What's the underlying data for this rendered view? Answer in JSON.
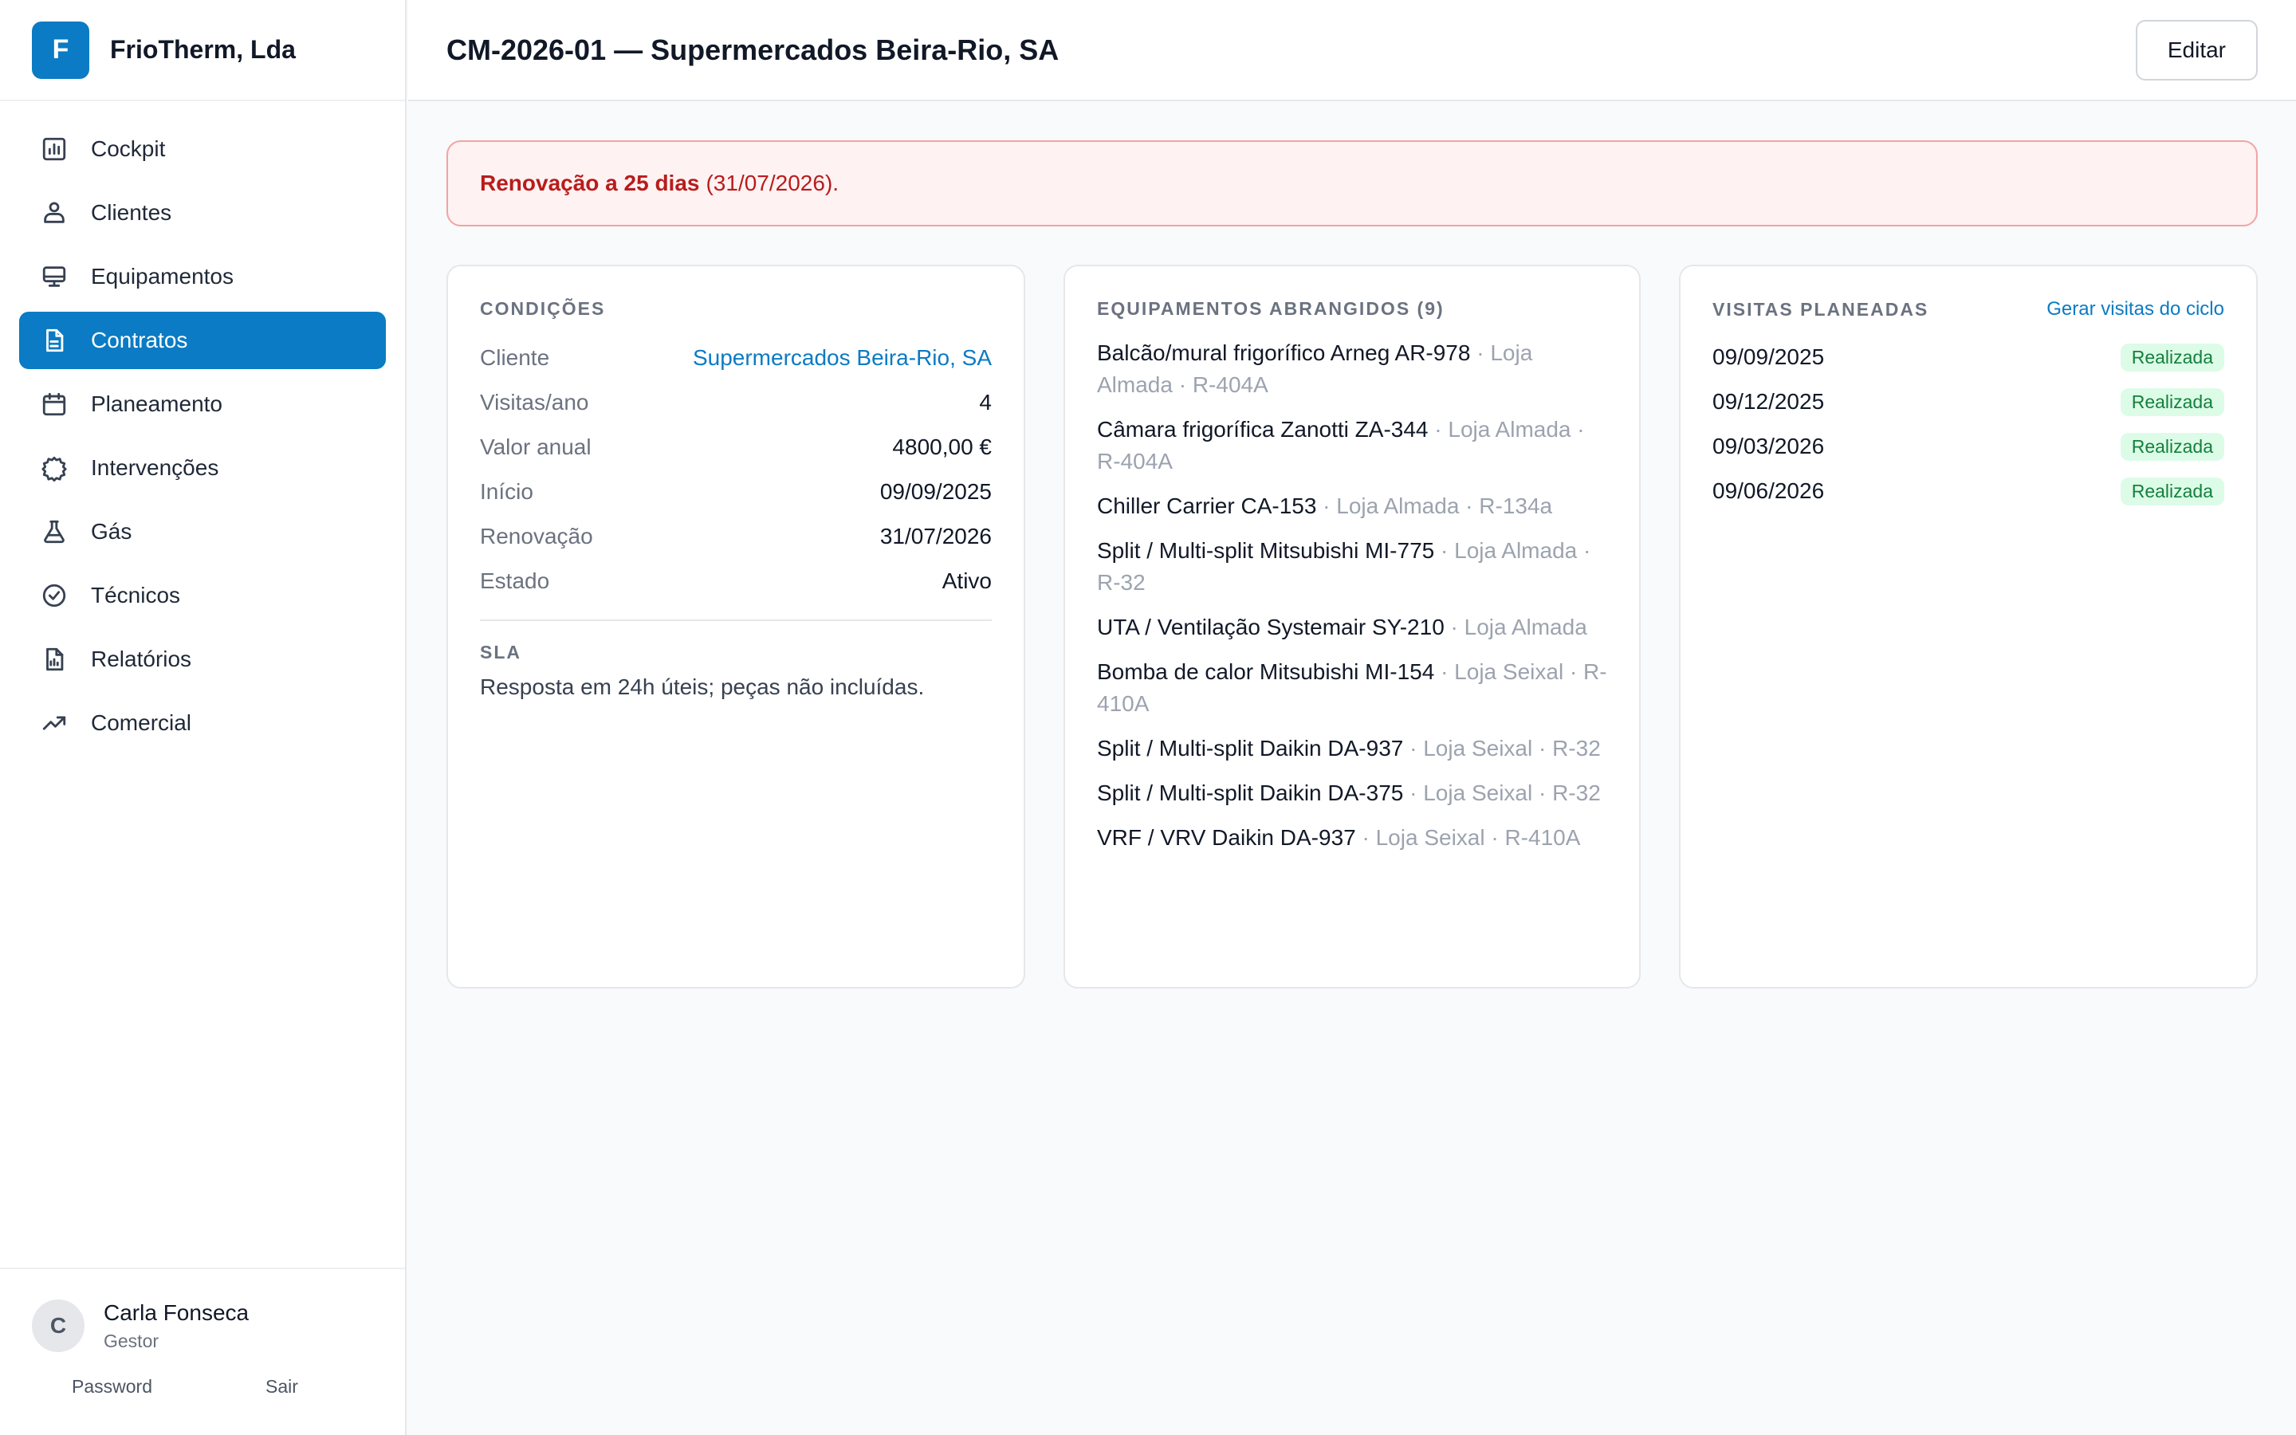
{
  "brand": {
    "initial": "F",
    "name": "FrioTherm, Lda"
  },
  "nav": [
    {
      "label": "Cockpit",
      "icon": "dashboard-icon",
      "active": false
    },
    {
      "label": "Clientes",
      "icon": "users-icon",
      "active": false
    },
    {
      "label": "Equipamentos",
      "icon": "monitor-icon",
      "active": false
    },
    {
      "label": "Contratos",
      "icon": "document-icon",
      "active": true
    },
    {
      "label": "Planeamento",
      "icon": "calendar-icon",
      "active": false
    },
    {
      "label": "Intervenções",
      "icon": "cog-icon",
      "active": false
    },
    {
      "label": "Gás",
      "icon": "flask-icon",
      "active": false
    },
    {
      "label": "Técnicos",
      "icon": "check-circle-icon",
      "active": false
    },
    {
      "label": "Relatórios",
      "icon": "report-icon",
      "active": false
    },
    {
      "label": "Comercial",
      "icon": "trending-up-icon",
      "active": false
    }
  ],
  "user": {
    "initial": "C",
    "name": "Carla Fonseca",
    "role": "Gestor",
    "password_label": "Password",
    "logout_label": "Sair"
  },
  "header": {
    "title": "CM-2026-01 — Supermercados Beira-Rio, SA",
    "edit_label": "Editar"
  },
  "alert": {
    "strong": "Renovação a 25 dias",
    "rest": "(31/07/2026)."
  },
  "conditions": {
    "title": "CONDIÇÕES",
    "rows": [
      {
        "k": "Cliente",
        "v": "Supermercados Beira-Rio, SA"
      },
      {
        "k": "Visitas/ano",
        "v": "4"
      },
      {
        "k": "Valor anual",
        "v": "4800,00 €"
      },
      {
        "k": "Início",
        "v": "09/09/2025"
      },
      {
        "k": "Renovação",
        "v": "31/07/2026"
      },
      {
        "k": "Estado",
        "v": "Ativo"
      }
    ],
    "sla_title": "SLA",
    "sla_text": "Resposta em 24h úteis; peças não incluídas."
  },
  "equipment": {
    "title": "EQUIPAMENTOS ABRANGIDOS (9)",
    "items": [
      {
        "name": "Balcão/mural frigorífico Arneg AR-978",
        "meta": " · Loja Almada · R-404A"
      },
      {
        "name": "Câmara frigorífica Zanotti ZA-344",
        "meta": " · Loja Almada · R-404A"
      },
      {
        "name": "Chiller Carrier CA-153",
        "meta": " · Loja Almada · R-134a"
      },
      {
        "name": "Split / Multi-split Mitsubishi MI-775",
        "meta": " · Loja Almada · R-32"
      },
      {
        "name": "UTA / Ventilação Systemair SY-210",
        "meta": " · Loja Almada"
      },
      {
        "name": "Bomba de calor Mitsubishi MI-154",
        "meta": " · Loja Seixal · R-410A"
      },
      {
        "name": "Split / Multi-split Daikin DA-937",
        "meta": " · Loja Seixal · R-32"
      },
      {
        "name": "Split / Multi-split Daikin DA-375",
        "meta": " · Loja Seixal · R-32"
      },
      {
        "name": "VRF / VRV Daikin DA-937",
        "meta": " · Loja Seixal · R-410A"
      }
    ]
  },
  "visits": {
    "title": "VISITAS PLANEADAS",
    "generate_label": "Gerar visitas do ciclo",
    "items": [
      {
        "date": "09/09/2025",
        "status": "Realizada"
      },
      {
        "date": "09/12/2025",
        "status": "Realizada"
      },
      {
        "date": "09/03/2026",
        "status": "Realizada"
      },
      {
        "date": "09/06/2026",
        "status": "Realizada"
      }
    ]
  },
  "colors": {
    "accent": "#0a7bc4",
    "alert_text": "#b91c1c",
    "alert_bg": "#fef2f2",
    "badge_bg": "#dcfce7",
    "badge_text": "#15803d"
  }
}
